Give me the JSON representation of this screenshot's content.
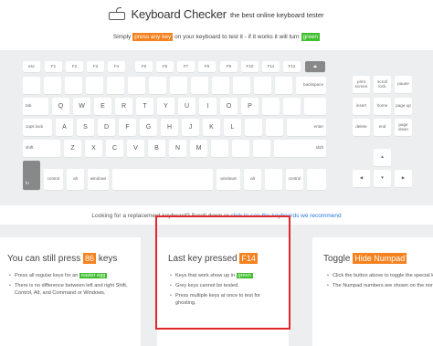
{
  "header": {
    "title": "Keyboard Checker",
    "subtitle": "the best online keyboard tester"
  },
  "instruction": {
    "pre": "Simply",
    "press": "press any key",
    "mid": "on your keyboard to test it - if it works it will turn",
    "green": "green"
  },
  "keys": {
    "esc": "esc",
    "f1": "F1",
    "f2": "F2",
    "f3": "F3",
    "f4": "F4",
    "f5": "F5",
    "f6": "F6",
    "f7": "F7",
    "f8": "F8",
    "f9": "F9",
    "f10": "F10",
    "f11": "F11",
    "f12": "F12",
    "eject": "⏏",
    "backspace": "backspace",
    "tab": "tab",
    "q": "Q",
    "w": "W",
    "e": "E",
    "r": "R",
    "t": "T",
    "y": "Y",
    "u": "U",
    "i": "I",
    "o": "O",
    "p": "P",
    "capslock": "caps lock",
    "a": "A",
    "s": "S",
    "d": "D",
    "f": "F",
    "g": "G",
    "h": "H",
    "j": "J",
    "k": "K",
    "l": "L",
    "enter": "enter",
    "shift_l": "shift",
    "z": "Z",
    "x": "X",
    "c": "C",
    "v": "V",
    "b": "B",
    "n": "N",
    "m": "M",
    "shift_r": "shift",
    "fn": "fn",
    "control": "control",
    "alt": "alt",
    "windows_l": "windows",
    "windows_r": "windows",
    "alt_r": "alt",
    "control_r": "control",
    "print_screen": "print screen",
    "scroll_lock": "scroll lock",
    "pause": "pause",
    "insert": "insert",
    "home": "home",
    "page_up": "page up",
    "delete": "delete",
    "end": "end",
    "page_down": "page down",
    "arrow_up": "▲",
    "arrow_left": "◀",
    "arrow_down": "▼",
    "arrow_right": "▶"
  },
  "replacement": {
    "text": "Looking for a replacement keyboard? Scroll down or",
    "link": "click to see the keyboards we recommend"
  },
  "panel_left": {
    "title_pre": "You can still press",
    "count": "86",
    "title_post": "keys",
    "b1_pre": "Press all regular keys for an",
    "b1_tag": "easter egg",
    "b2": "There is no difference between left and right Shift, Control, Alt, and Command or Windows."
  },
  "panel_mid": {
    "title_pre": "Last key pressed",
    "key": "F14",
    "b1_pre": "Keys that work show up in",
    "b1_tag": "green",
    "b2": "Grey keys cannot be tested.",
    "b3": "Press multiple keys at once to test for ghosting."
  },
  "panel_right": {
    "title_pre": "Toggle",
    "tag": "Hide Numpad",
    "b1": "Click the button above to toggle the special keys.",
    "b2": "The Numpad numbers are shown on the normal bar when tested."
  },
  "colors": {
    "accent_orange": "#f5821f",
    "accent_green": "#3fbf2e",
    "highlight_red": "#e0282c",
    "link": "#2a7ae2"
  }
}
